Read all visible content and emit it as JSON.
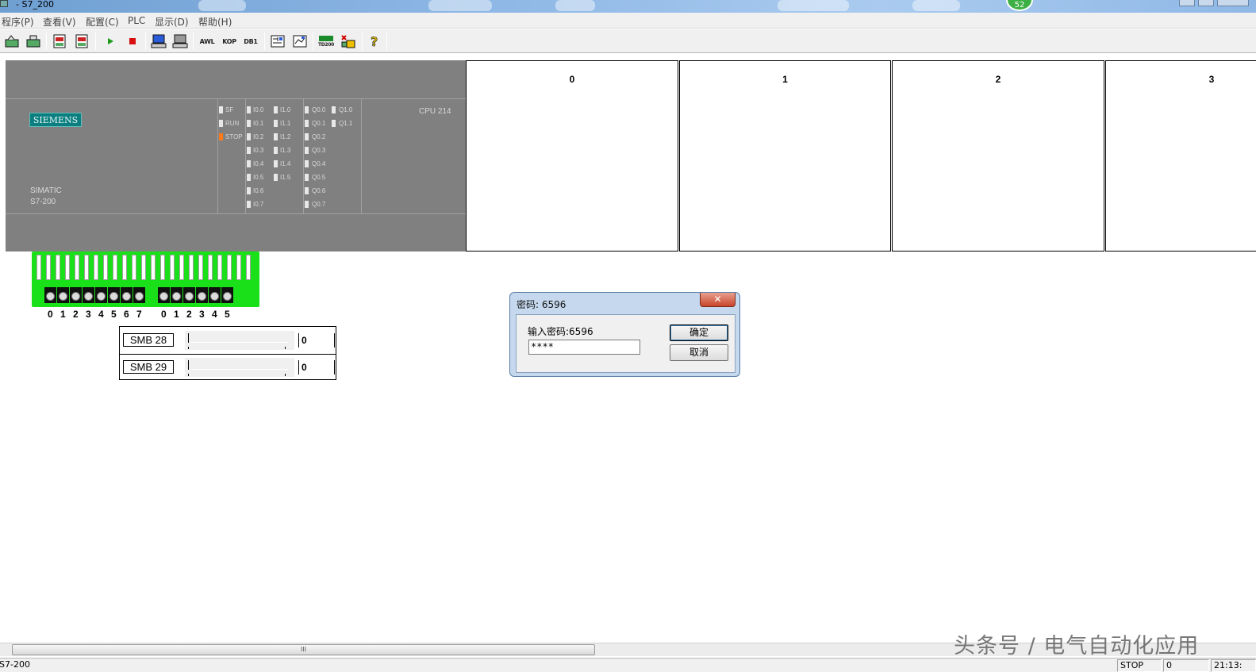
{
  "window": {
    "title": "- S7_200",
    "notification_count": "52"
  },
  "menu": [
    "程序(P)",
    "查看(V)",
    "配置(C)",
    "PLC",
    "显示(D)",
    "帮助(H)"
  ],
  "toolbar": {
    "awl_label": "AWL",
    "kop_label": "KOP",
    "db1_label": "DB1",
    "td200_label": "TD200"
  },
  "plc": {
    "brand": "SIEMENS",
    "family_line1": "SIMATIC",
    "family_line2": "S7-200",
    "cpu": "CPU 214",
    "status_leds": [
      {
        "label": "SF",
        "on": false
      },
      {
        "label": "RUN",
        "on": false
      },
      {
        "label": "STOP",
        "on": true
      }
    ],
    "inputs_col1": [
      "I0.0",
      "I0.1",
      "I0.2",
      "I0.3",
      "I0.4",
      "I0.5",
      "I0.6",
      "I0.7"
    ],
    "inputs_col2": [
      "I1.0",
      "I1.1",
      "I1.2",
      "I1.3",
      "I1.4",
      "I1.5"
    ],
    "outputs_col1": [
      "Q0.0",
      "Q0.1",
      "Q0.2",
      "Q0.3",
      "Q0.4",
      "Q0.5",
      "Q0.6",
      "Q0.7"
    ],
    "outputs_col2": [
      "Q1.0",
      "Q1.1"
    ]
  },
  "modules": [
    "0",
    "1",
    "2",
    "3"
  ],
  "switches": {
    "group1": [
      "0",
      "1",
      "2",
      "3",
      "4",
      "5",
      "6",
      "7"
    ],
    "group2": [
      "0",
      "1",
      "2",
      "3",
      "4",
      "5"
    ]
  },
  "smb": [
    {
      "label": "SMB 28",
      "value": "0"
    },
    {
      "label": "SMB 29",
      "value": "0"
    }
  ],
  "dialog": {
    "title": "密码: 6596",
    "close": "✕",
    "prompt": "输入密码:6596",
    "input_value": "****",
    "ok_label": "确定",
    "cancel_label": "取消"
  },
  "scrollbar": {
    "grip": "III"
  },
  "status": {
    "left": "S7-200",
    "mode": "STOP",
    "value": "0",
    "time": "21:13:"
  },
  "watermark": "头条号 / 电气自动化应用"
}
